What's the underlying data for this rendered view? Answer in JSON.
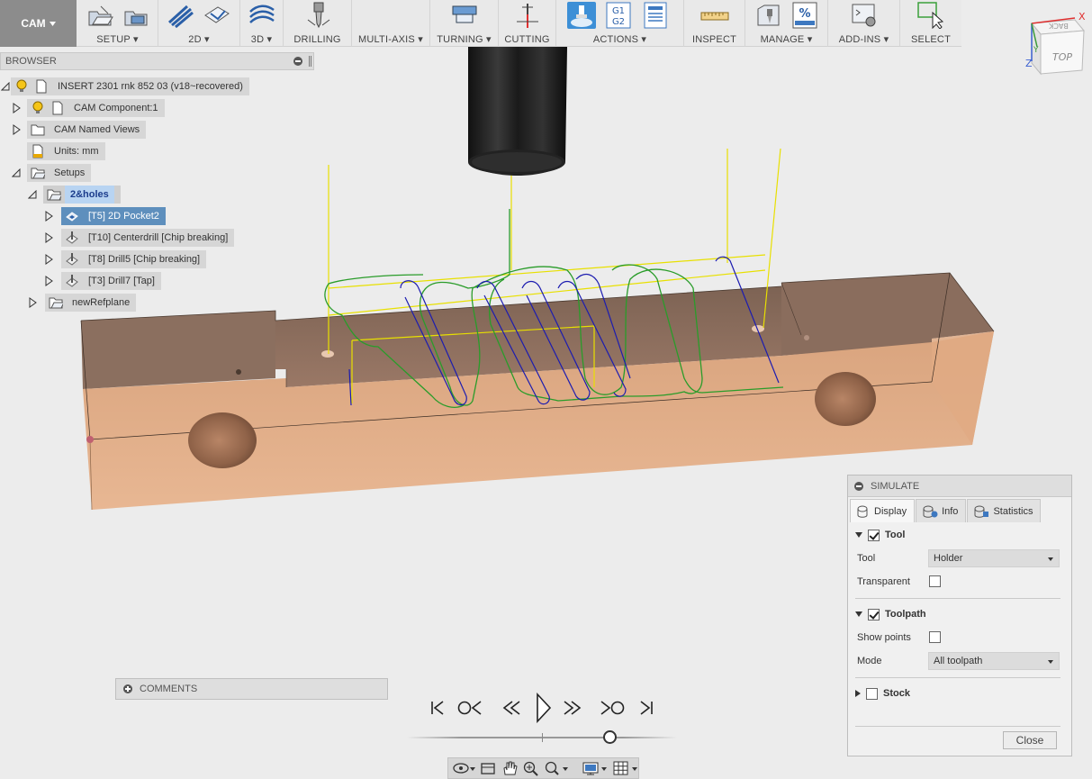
{
  "workspace": "CAM",
  "toolbar": {
    "groups": [
      {
        "label": "SETUP",
        "dropdown": true
      },
      {
        "label": "2D",
        "dropdown": true
      },
      {
        "label": "3D",
        "dropdown": true
      },
      {
        "label": "DRILLING",
        "dropdown": false
      },
      {
        "label": "MULTI-AXIS",
        "dropdown": true
      },
      {
        "label": "TURNING",
        "dropdown": true
      },
      {
        "label": "CUTTING",
        "dropdown": false
      },
      {
        "label": "ACTIONS",
        "dropdown": true
      },
      {
        "label": "INSPECT",
        "dropdown": false
      },
      {
        "label": "MANAGE",
        "dropdown": true
      },
      {
        "label": "ADD-INS",
        "dropdown": true
      },
      {
        "label": "SELECT",
        "dropdown": false
      }
    ],
    "gcode_icon_line1": "G1",
    "gcode_icon_line2": "G2",
    "manage_percent_icon": "%"
  },
  "browser": {
    "title": "BROWSER",
    "nodes": [
      {
        "label": "INSERT 2301 rnk 852 03 (v18~recovered)"
      },
      {
        "label": "CAM Component:1"
      },
      {
        "label": "CAM Named Views"
      },
      {
        "label": "Units: mm"
      },
      {
        "label": "Setups"
      },
      {
        "label": "2&holes"
      },
      {
        "label": "[T5] 2D Pocket2"
      },
      {
        "label": "[T10] Centerdrill [Chip breaking]"
      },
      {
        "label": "[T8] Drill5 [Chip breaking]"
      },
      {
        "label": "[T3] Drill7 [Tap]"
      },
      {
        "label": "newRefplane"
      }
    ]
  },
  "viewcube": {
    "face_top": "TOP",
    "face_back": "BACK",
    "axis_x": "X",
    "axis_z": "Z",
    "axis_y": "Y",
    "colors": {
      "x": "#e03030",
      "y": "#3a9a3a",
      "z": "#3a5fd0"
    }
  },
  "comments": {
    "label": "COMMENTS"
  },
  "simulate": {
    "title": "SIMULATE",
    "tabs": [
      {
        "label": "Display"
      },
      {
        "label": "Info"
      },
      {
        "label": "Statistics"
      }
    ],
    "tool_section": {
      "label": "Tool",
      "tool_field_label": "Tool",
      "tool_field_value": "Holder",
      "transparent_label": "Transparent"
    },
    "toolpath_section": {
      "label": "Toolpath",
      "show_points_label": "Show points",
      "mode_label": "Mode",
      "mode_value": "All toolpath"
    },
    "stock_section": {
      "label": "Stock"
    },
    "close_label": "Close"
  },
  "colors": {
    "stock": "#d9a47e",
    "stock_top": "#8f7262",
    "toolpath_feed": "#2a9c2a",
    "toolpath_plunge": "#1c1cb0",
    "toolpath_rapid": "#e8e000",
    "accent": "#3d8fd6"
  },
  "playback": {
    "progress": 0.75
  }
}
